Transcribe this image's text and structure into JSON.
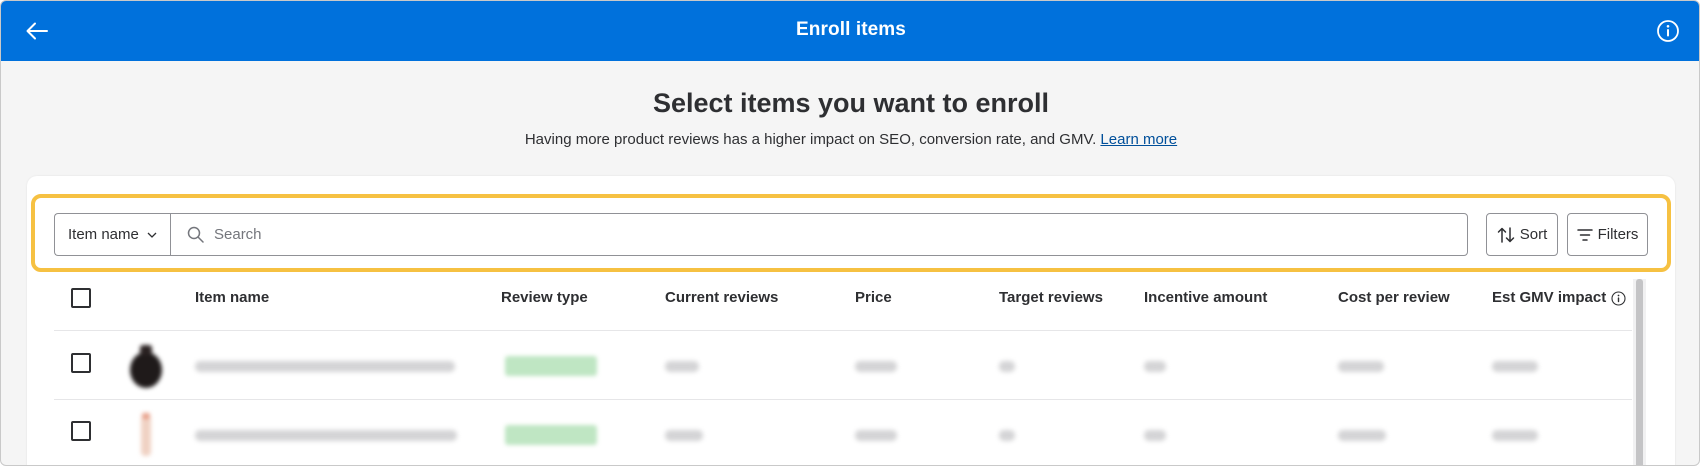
{
  "topbar": {
    "title": "Enroll items",
    "back_icon": "arrow-left-icon",
    "info_icon": "info-icon",
    "color": "#0071dc"
  },
  "page": {
    "heading": "Select items you want to enroll",
    "description": "Having more product reviews has a higher impact on SEO, conversion rate, and GMV.",
    "learn_more": "Learn more"
  },
  "toolbar": {
    "filter_field": "Item name",
    "search_placeholder": "Search",
    "sort_label": "Sort",
    "filters_label": "Filters",
    "highlight_color": "#f6c142"
  },
  "table": {
    "columns": [
      "Item name",
      "Review type",
      "Current reviews",
      "Price",
      "Target reviews",
      "Incentive amount",
      "Cost per review",
      "Est GMV impact"
    ],
    "row_count_visible": 2
  }
}
